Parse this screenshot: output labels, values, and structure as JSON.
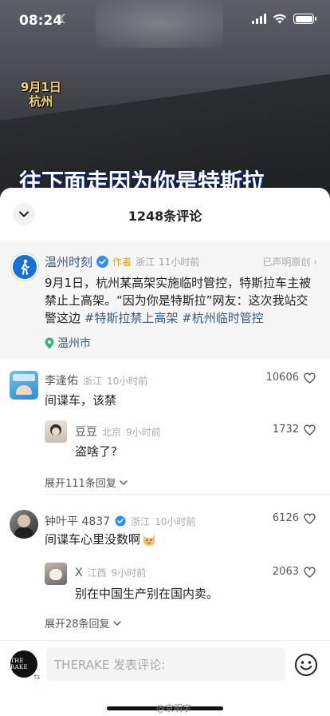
{
  "status_bar": {
    "time": "08:24"
  },
  "video": {
    "date_line1": "9月1日",
    "date_line2": "杭州",
    "subtitle": "往下面走因为你是特斯拉"
  },
  "sheet": {
    "title": "1248条评论"
  },
  "post": {
    "author": "温州时刻",
    "author_tag": "作者",
    "region": "浙江",
    "time": "11小时前",
    "claim": "已声明原创",
    "text_main": "9月1日，杭州某高架实施临时管控，特斯拉车主被禁止上高架。“因为你是特斯拉”网友：这次我站交警这边",
    "hashtag1": "#特斯拉禁上高架",
    "hashtag2": "#杭州临时管控",
    "location": "温州市"
  },
  "comments": [
    {
      "name": "李逢佑",
      "region": "浙江",
      "time": "10小时前",
      "text": "间谍车，该禁",
      "likes": "10606",
      "reply": {
        "name": "豆豆",
        "region": "北京",
        "time": "9小时前",
        "text": "盗啥了?",
        "likes": "1732"
      },
      "expand": "展开111条回复"
    },
    {
      "name": "钟叶平 4837",
      "region": "浙江",
      "time": "10小时前",
      "text": "间谍车心里没数啊",
      "likes": "6126",
      "reply": {
        "name": "X",
        "region": "江西",
        "time": "9小时前",
        "text": "别在中国生产别在国内卖。",
        "likes": "2063"
      },
      "expand": "展开28条回复"
    }
  ],
  "bottom_bar": {
    "avatar_text": "THE RAKE",
    "input_placeholder": "THERAKE 发表评论:",
    "watermark": "@京明宇"
  },
  "colors": {
    "link_blue": "#3a5a82",
    "author_orange": "#e8a01a",
    "verified_blue": "#2d8cf0"
  }
}
